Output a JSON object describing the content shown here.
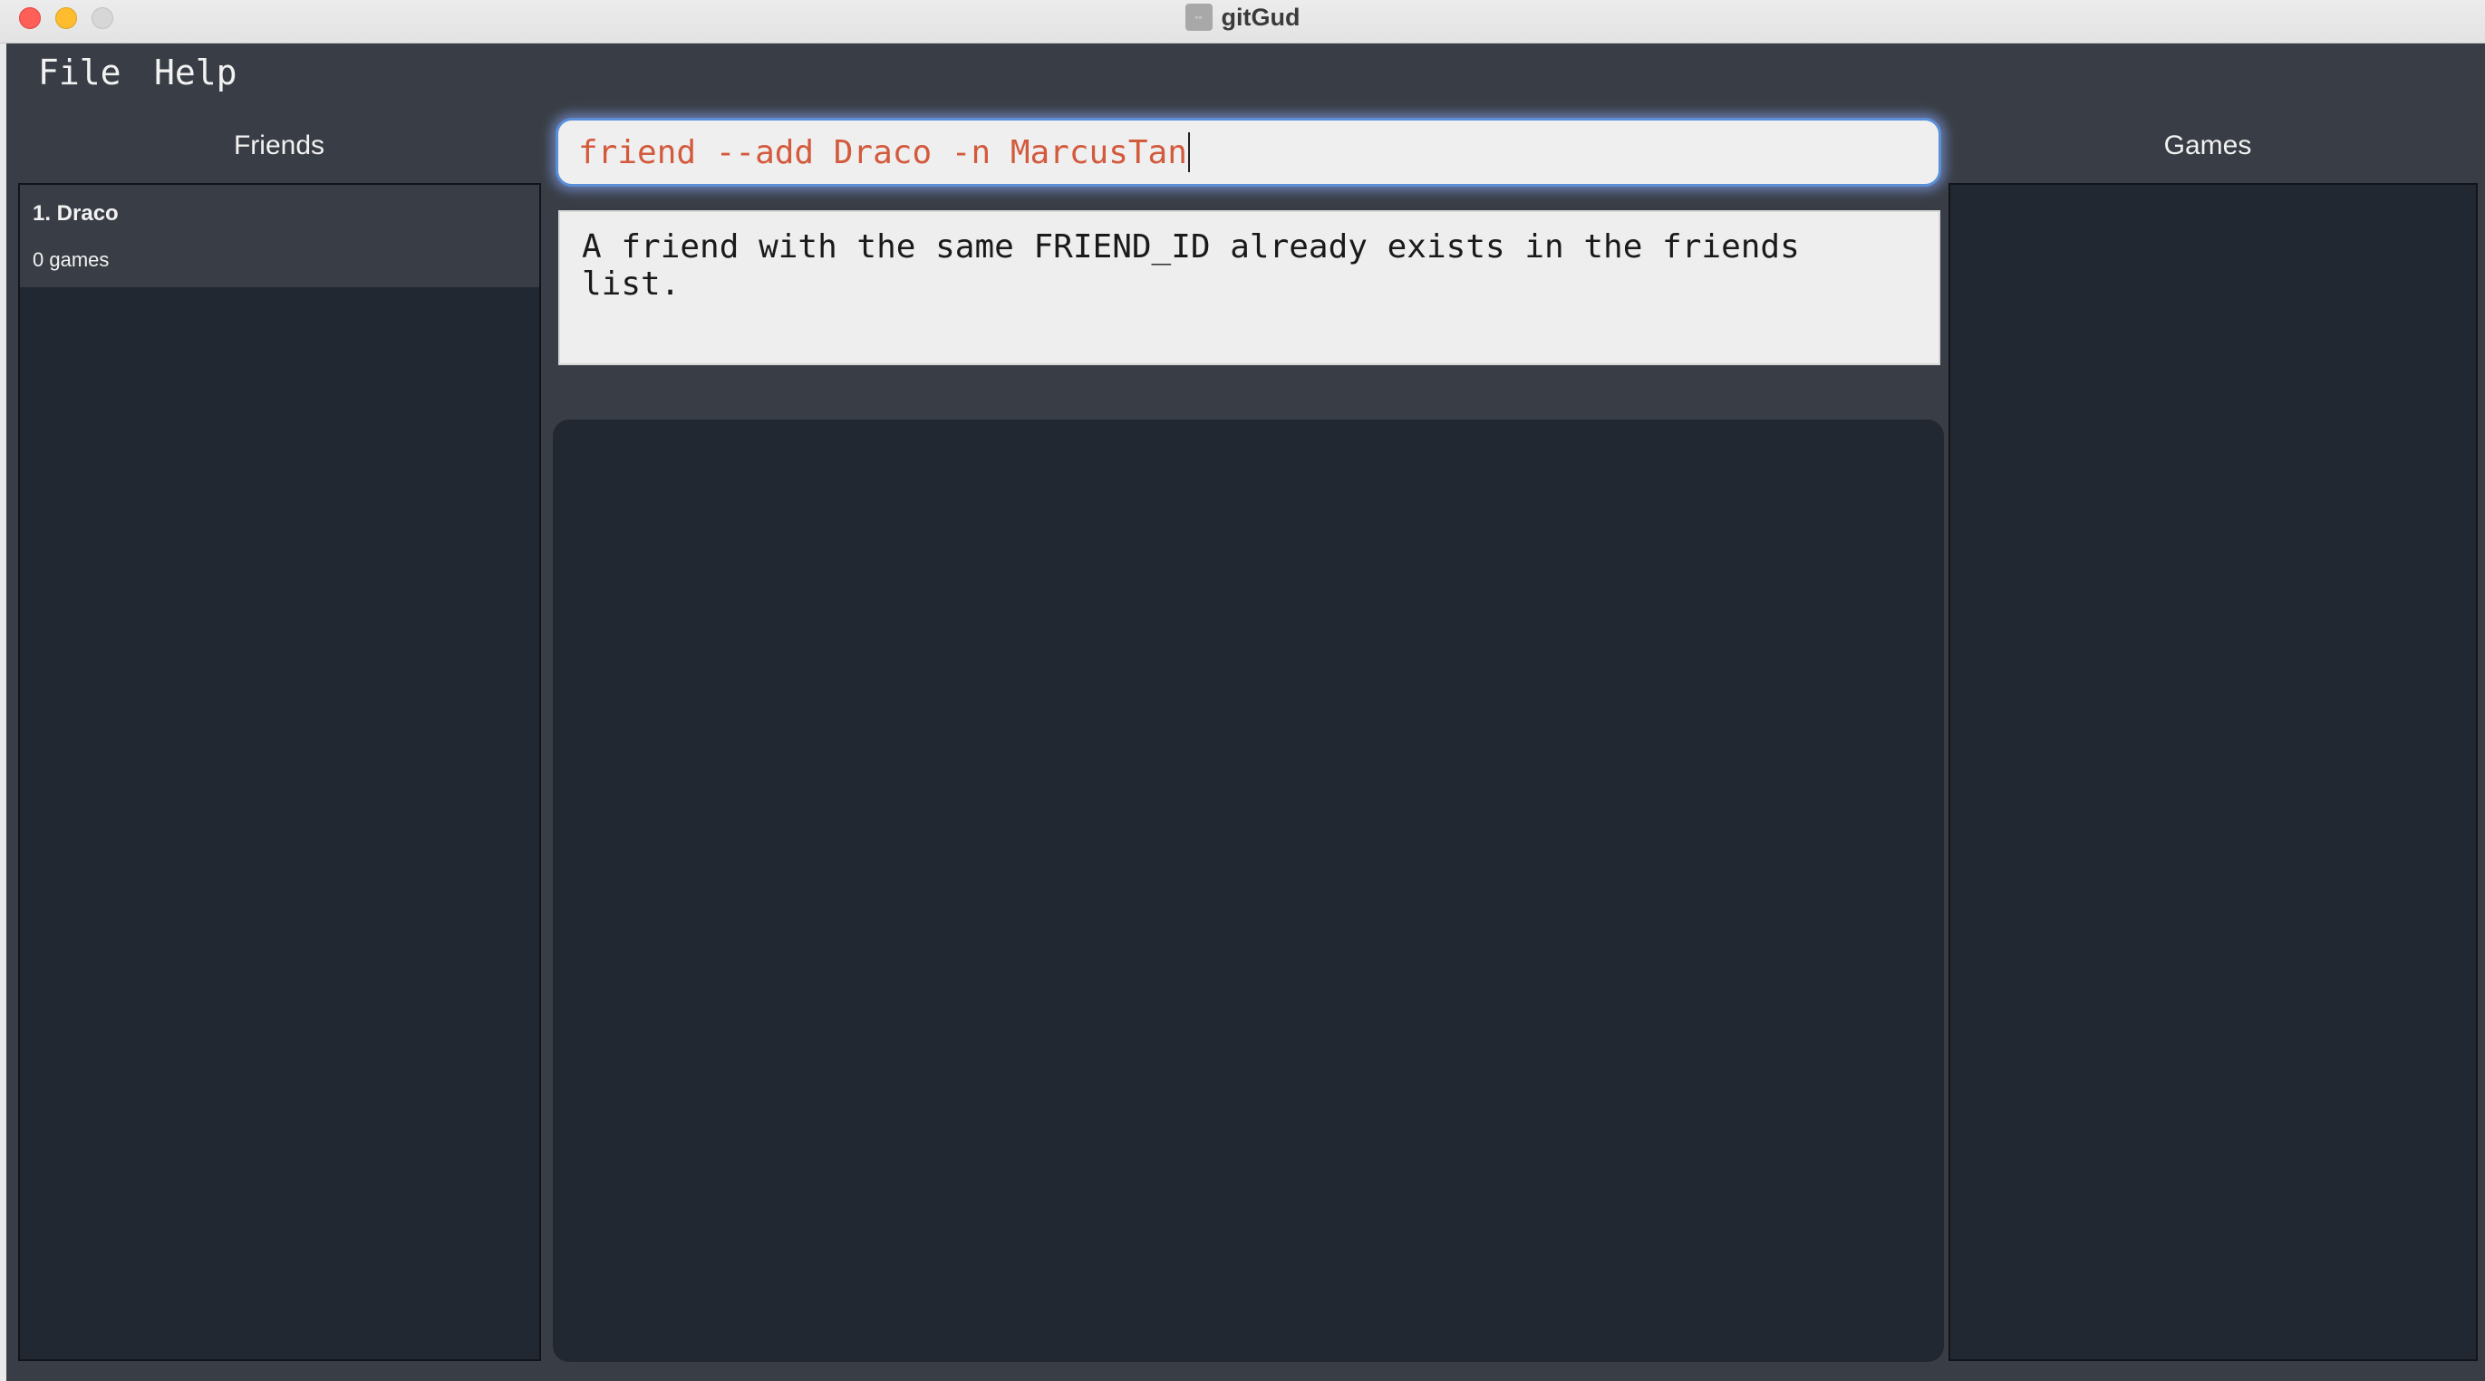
{
  "window": {
    "title": "gitGud"
  },
  "menu": {
    "file": "File",
    "help": "Help"
  },
  "friends_panel": {
    "heading": "Friends",
    "items": [
      {
        "name": "1. Draco",
        "subtitle": "0 games"
      }
    ]
  },
  "games_panel": {
    "heading": "Games",
    "items": []
  },
  "command": {
    "value": "friend --add Draco -n MarcusTan"
  },
  "result": {
    "message": "A friend with the same FRIEND_ID already exists in the friends list."
  },
  "colors": {
    "app_background": "#393e46",
    "panel_background": "#222831",
    "command_text": "#d35a3c",
    "focus_ring": "#5a8fd6"
  }
}
